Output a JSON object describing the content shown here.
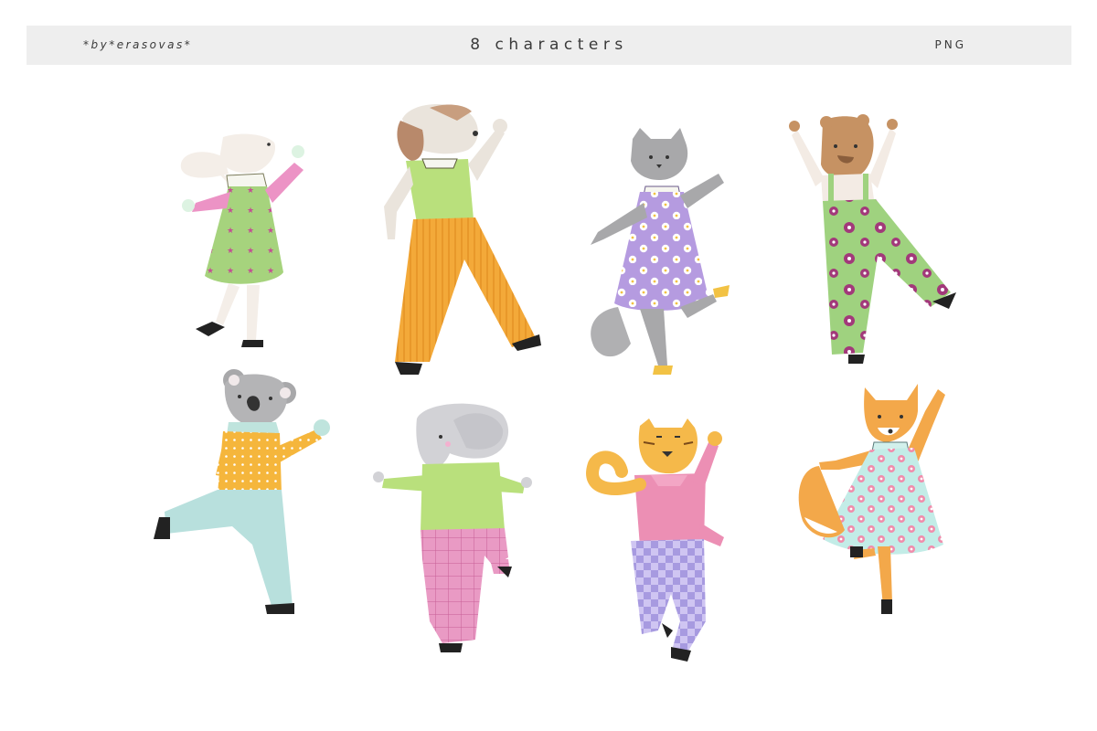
{
  "header": {
    "brand": "*by*erasovas*",
    "title": "8 characters",
    "format": "PNG"
  },
  "characters": [
    {
      "icon": "bunny-icon",
      "outfit": "dress",
      "color": "#a6d37d"
    },
    {
      "icon": "dog-icon",
      "outfit": "wide-pants",
      "color": "#f3a939"
    },
    {
      "icon": "cat-icon",
      "outfit": "dress",
      "color": "#b59be0"
    },
    {
      "icon": "bear-icon",
      "outfit": "overalls",
      "color": "#9fd27f"
    },
    {
      "icon": "koala-icon",
      "outfit": "pants",
      "color": "#b8e0dd"
    },
    {
      "icon": "elephant-icon",
      "outfit": "pants",
      "color": "#e88fbf"
    },
    {
      "icon": "tiger-icon",
      "outfit": "pants",
      "color": "#a79ae0"
    },
    {
      "icon": "fox-icon",
      "outfit": "dress",
      "color": "#c3ece7"
    }
  ],
  "colors": {
    "header_bg": "#eeeeee",
    "header_text": "#3a3a3a",
    "background": "#ffffff"
  }
}
